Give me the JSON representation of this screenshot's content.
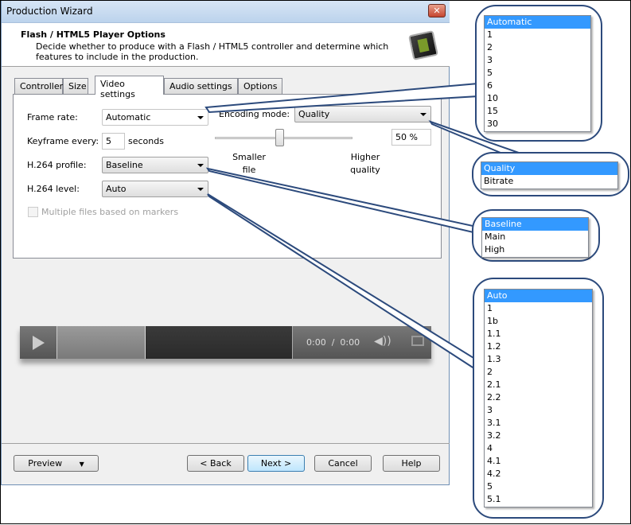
{
  "window": {
    "title": "Production Wizard",
    "close": "✕"
  },
  "header": {
    "title": "Flash / HTML5 Player Options",
    "description": "Decide whether to produce with a Flash / HTML5 controller and determine which features to include in the production."
  },
  "tabs": [
    "Controller",
    "Size",
    "Video settings",
    "Audio settings",
    "Options"
  ],
  "selected_tab": "Video settings",
  "video": {
    "frame_rate_label": "Frame rate:",
    "frame_rate": "Automatic",
    "keyframe_label": "Keyframe every:",
    "keyframe_value": "5",
    "keyframe_unit": "seconds",
    "profile_label": "H.264 profile:",
    "profile": "Baseline",
    "level_label": "H.264 level:",
    "level": "Auto",
    "multiple_files_label": "Multiple files based on markers",
    "multiple_files_checked": false,
    "encoding_mode_label": "Encoding mode:",
    "encoding_mode": "Quality",
    "quality_percent": 50,
    "quality_value": "50 %",
    "slider_min_label": "Smaller file",
    "slider_max_label": "Higher quality"
  },
  "player": {
    "time": "0:00  /  0:00"
  },
  "buttons": {
    "preview": "Preview",
    "back": "< Back",
    "next": "Next >",
    "cancel": "Cancel",
    "help": "Help"
  },
  "callouts": {
    "frame_rate_options": [
      "Automatic",
      "1",
      "2",
      "3",
      "5",
      "6",
      "10",
      "15",
      "30"
    ],
    "encoding_mode_options": [
      "Quality",
      "Bitrate"
    ],
    "profile_options": [
      "Baseline",
      "Main",
      "High"
    ],
    "level_options": [
      "Auto",
      "1",
      "1b",
      "1.1",
      "1.2",
      "1.3",
      "2",
      "2.1",
      "2.2",
      "3",
      "3.1",
      "3.2",
      "4",
      "4.1",
      "4.2",
      "5",
      "5.1"
    ]
  },
  "colors": {
    "callout_border": "#2c4a7c",
    "selection": "#3399ff"
  }
}
